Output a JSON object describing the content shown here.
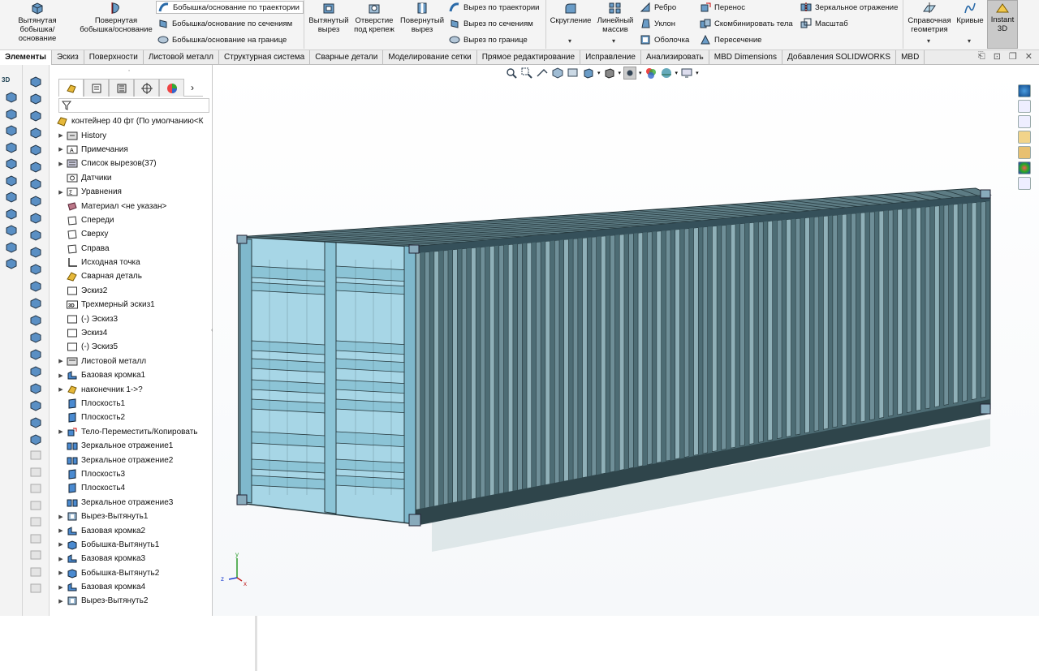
{
  "ribbon": {
    "big_buttons": [
      {
        "id": "extruded-boss",
        "label": "Вытянутая бобышка/основание"
      },
      {
        "id": "revolved-boss",
        "label": "Повернутая бобышка/основание"
      },
      {
        "id": "extruded-cut",
        "label": "Вытянутый вырез"
      },
      {
        "id": "hole-wizard",
        "label": "Отверстие под крепеж"
      },
      {
        "id": "revolved-cut",
        "label": "Повернутый вырез"
      },
      {
        "id": "fillet",
        "label": "Скругление"
      },
      {
        "id": "linear-pattern",
        "label": "Линейный массив"
      },
      {
        "id": "reference-geometry",
        "label": "Справочная геометрия"
      },
      {
        "id": "curves",
        "label": "Кривые"
      }
    ],
    "small_buttons": {
      "swept_boss": "Бобышка/основание по траектории",
      "lofted_boss": "Бобышка/основание по сечениям",
      "boundary_boss": "Бобышка/основание на границе",
      "swept_cut": "Вырез по траектории",
      "lofted_cut": "Вырез по сечениям",
      "boundary_cut": "Вырез по границе",
      "rib": "Ребро",
      "draft": "Уклон",
      "shell": "Оболочка",
      "move": "Перенос",
      "combine": "Скомбинировать тела",
      "intersect": "Пересечение",
      "mirror": "Зеркальное отражение",
      "scale": "Масштаб"
    },
    "instant3d": "Instant 3D"
  },
  "tabs": [
    "Элементы",
    "Эскиз",
    "Поверхности",
    "Листовой металл",
    "Структурная система",
    "Сварные детали",
    "Моделирование сетки",
    "Прямое редактирование",
    "Исправление",
    "Анализировать",
    "MBD Dimensions",
    "Добавления SOLIDWORKS",
    "MBD"
  ],
  "active_tab": "Элементы",
  "left_toolbar_label": "3D",
  "tree": {
    "root": "контейнер 40 фт (По умолчанию<К",
    "items": [
      {
        "label": "History",
        "expandable": true,
        "icon": "history-icon"
      },
      {
        "label": "Примечания",
        "expandable": true,
        "icon": "annotations-icon"
      },
      {
        "label": "Список вырезов(37)",
        "expandable": true,
        "icon": "cutlist-icon"
      },
      {
        "label": "Датчики",
        "expandable": false,
        "icon": "sensor-icon"
      },
      {
        "label": "Уравнения",
        "expandable": true,
        "icon": "equations-icon"
      },
      {
        "label": "Материал <не указан>",
        "expandable": false,
        "icon": "material-icon"
      },
      {
        "label": "Спереди",
        "expandable": false,
        "icon": "plane-icon"
      },
      {
        "label": "Сверху",
        "expandable": false,
        "icon": "plane-icon"
      },
      {
        "label": "Справа",
        "expandable": false,
        "icon": "plane-icon"
      },
      {
        "label": "Исходная точка",
        "expandable": false,
        "icon": "origin-icon"
      },
      {
        "label": "Сварная деталь",
        "expandable": false,
        "icon": "weldment-icon"
      },
      {
        "label": "Эскиз2",
        "expandable": false,
        "icon": "sketch-icon"
      },
      {
        "label": "Трехмерный эскиз1",
        "expandable": false,
        "icon": "sketch3d-icon"
      },
      {
        "label": "(-) Эскиз3",
        "expandable": false,
        "icon": "sketch-icon"
      },
      {
        "label": "Эскиз4",
        "expandable": false,
        "icon": "sketch-icon"
      },
      {
        "label": "(-) Эскиз5",
        "expandable": false,
        "icon": "sketch-icon"
      },
      {
        "label": "Листовой металл",
        "expandable": true,
        "icon": "sheetmetal-icon"
      },
      {
        "label": "Базовая кромка1",
        "expandable": true,
        "icon": "baseflange-icon"
      },
      {
        "label": "наконечник 1->?",
        "expandable": true,
        "icon": "endcap-icon"
      },
      {
        "label": "Плоскость1",
        "expandable": false,
        "icon": "refplane-icon"
      },
      {
        "label": "Плоскость2",
        "expandable": false,
        "icon": "refplane-icon"
      },
      {
        "label": "Тело-Переместить/Копировать",
        "expandable": true,
        "icon": "movebody-icon"
      },
      {
        "label": "Зеркальное отражение1",
        "expandable": false,
        "icon": "mirror-icon"
      },
      {
        "label": "Зеркальное отражение2",
        "expandable": false,
        "icon": "mirror-icon"
      },
      {
        "label": "Плоскость3",
        "expandable": false,
        "icon": "refplane-icon"
      },
      {
        "label": "Плоскость4",
        "expandable": false,
        "icon": "refplane-icon"
      },
      {
        "label": "Зеркальное отражение3",
        "expandable": false,
        "icon": "mirror-icon"
      },
      {
        "label": "Вырез-Вытянуть1",
        "expandable": true,
        "icon": "cut-icon"
      },
      {
        "label": "Базовая кромка2",
        "expandable": true,
        "icon": "baseflange-icon"
      },
      {
        "label": "Бобышка-Вытянуть1",
        "expandable": true,
        "icon": "boss-icon"
      },
      {
        "label": "Базовая кромка3",
        "expandable": true,
        "icon": "baseflange-icon"
      },
      {
        "label": "Бобышка-Вытянуть2",
        "expandable": true,
        "icon": "boss-icon"
      },
      {
        "label": "Базовая кромка4",
        "expandable": true,
        "icon": "baseflange-icon"
      },
      {
        "label": "Вырез-Вытянуть2",
        "expandable": true,
        "icon": "cut-icon"
      }
    ]
  },
  "triad": {
    "x": "x",
    "y": "y",
    "z": "z"
  },
  "colors": {
    "container_front": "#a7d6e6",
    "container_side": "#4d6c74",
    "container_dark": "#26383d",
    "accent": "#2f7cc4"
  }
}
